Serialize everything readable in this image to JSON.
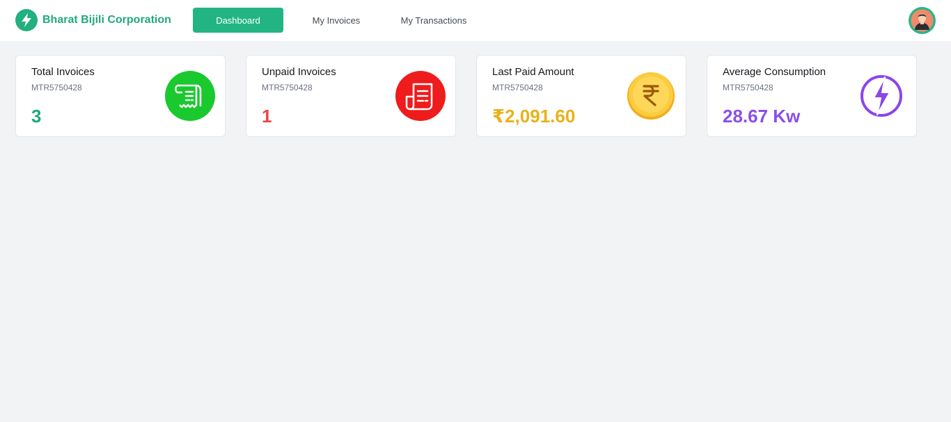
{
  "brand": {
    "name": "Bharat Bijili Corporation",
    "logo_icon": "lightning-icon",
    "accent": "#21b07e"
  },
  "nav": {
    "dashboard": "Dashboard",
    "invoices": "My Invoices",
    "transactions": "My Transactions",
    "active": "Dashboard"
  },
  "user": {
    "avatar_icon": "user-avatar-icon"
  },
  "cards": [
    {
      "title": "Total Invoices",
      "meter": "MTR5750428",
      "value": "3",
      "value_color": "#22a87a",
      "icon": "receipt-icon",
      "icon_color": "#19c92e"
    },
    {
      "title": "Unpaid Invoices",
      "meter": "MTR5750428",
      "value": "1",
      "value_color": "#ef4444",
      "icon": "document-icon",
      "icon_color": "#ee1c1c"
    },
    {
      "title": "Last Paid Amount",
      "meter": "MTR5750428",
      "value": "₹2,091.60",
      "value_color": "#e6b21a",
      "icon": "rupee-coin-icon",
      "icon_color": "#f7c531"
    },
    {
      "title": "Average Consumption",
      "meter": "MTR5750428",
      "value": "28.67 Kw",
      "value_color": "#8a4fe8",
      "icon": "lightning-icon",
      "icon_color": "#8b46ea"
    }
  ]
}
